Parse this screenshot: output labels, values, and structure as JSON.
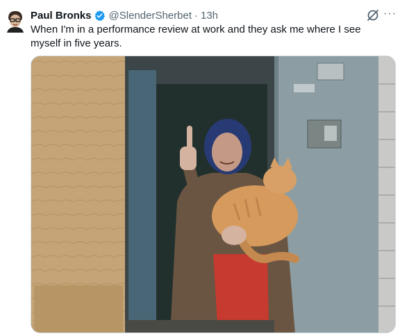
{
  "tweet": {
    "author_name": "Paul Bronks",
    "handle": "@SlenderSherbet",
    "separator": "·",
    "time": "13h",
    "text": "When I'm in a performance review at work and they ask me where I see myself in five years.",
    "more_label": "···",
    "verified_color": "#1d9bf0"
  },
  "icons": {
    "verified": "verified-badge-icon",
    "grok": "grok-icon",
    "more": "more-dots-icon"
  }
}
